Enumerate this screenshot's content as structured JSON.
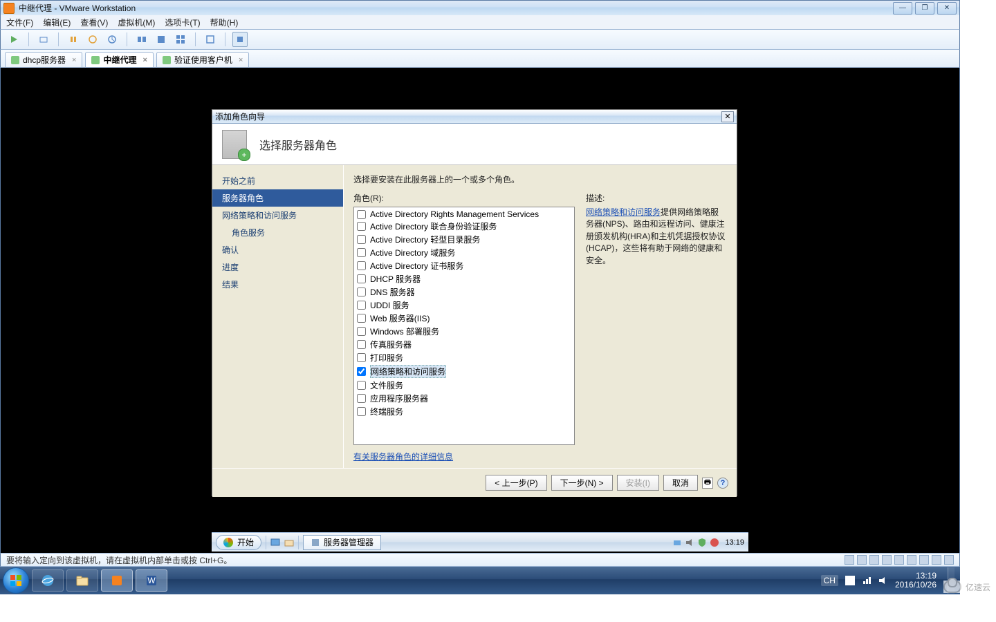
{
  "host_window": {
    "title": "中继代理 - VMware Workstation",
    "menus": [
      "文件(F)",
      "编辑(E)",
      "查看(V)",
      "虚拟机(M)",
      "选项卡(T)",
      "帮助(H)"
    ],
    "tabs": [
      {
        "label": "dhcp服务器",
        "active": false
      },
      {
        "label": "中继代理",
        "active": true
      },
      {
        "label": "验证使用客户机",
        "active": false
      }
    ],
    "status_text": "要将输入定向到该虚拟机，请在虚拟机内部单击或按 Ctrl+G。"
  },
  "wizard": {
    "title": "添加角色向导",
    "heading": "选择服务器角色",
    "nav": [
      {
        "label": "开始之前",
        "sel": false
      },
      {
        "label": "服务器角色",
        "sel": true
      },
      {
        "label": "网络策略和访问服务",
        "sel": false
      },
      {
        "label": "角色服务",
        "sel": false,
        "sub": true
      },
      {
        "label": "确认",
        "sel": false
      },
      {
        "label": "进度",
        "sel": false
      },
      {
        "label": "结果",
        "sel": false
      }
    ],
    "instruction": "选择要安装在此服务器上的一个或多个角色。",
    "roles_label": "角色(R):",
    "roles": [
      {
        "label": "Active Directory Rights Management Services",
        "checked": false
      },
      {
        "label": "Active Directory 联合身份验证服务",
        "checked": false
      },
      {
        "label": "Active Directory 轻型目录服务",
        "checked": false
      },
      {
        "label": "Active Directory 域服务",
        "checked": false
      },
      {
        "label": "Active Directory 证书服务",
        "checked": false
      },
      {
        "label": "DHCP 服务器",
        "checked": false
      },
      {
        "label": "DNS 服务器",
        "checked": false
      },
      {
        "label": "UDDI 服务",
        "checked": false
      },
      {
        "label": "Web 服务器(IIS)",
        "checked": false
      },
      {
        "label": "Windows 部署服务",
        "checked": false
      },
      {
        "label": "传真服务器",
        "checked": false
      },
      {
        "label": "打印服务",
        "checked": false
      },
      {
        "label": "网络策略和访问服务",
        "checked": true,
        "sel": true
      },
      {
        "label": "文件服务",
        "checked": false
      },
      {
        "label": "应用程序服务器",
        "checked": false
      },
      {
        "label": "终端服务",
        "checked": false
      }
    ],
    "desc_label": "描述:",
    "desc_link": "网络策略和访问服务",
    "desc_rest": "提供网络策略服务器(NPS)、路由和远程访问、健康注册颁发机构(HRA)和主机凭据授权协议(HCAP)，这些将有助于网络的健康和安全。",
    "more_link": "有关服务器角色的详细信息",
    "buttons": {
      "prev": "< 上一步(P)",
      "next": "下一步(N) >",
      "install": "安装(I)",
      "cancel": "取消"
    }
  },
  "guest_taskbar": {
    "start": "开始",
    "task_item": "服务器管理器",
    "clock": "13:19"
  },
  "host_taskbar": {
    "lang": "CH",
    "time": "13:19",
    "date": "2016/10/26"
  },
  "watermark": "亿速云"
}
